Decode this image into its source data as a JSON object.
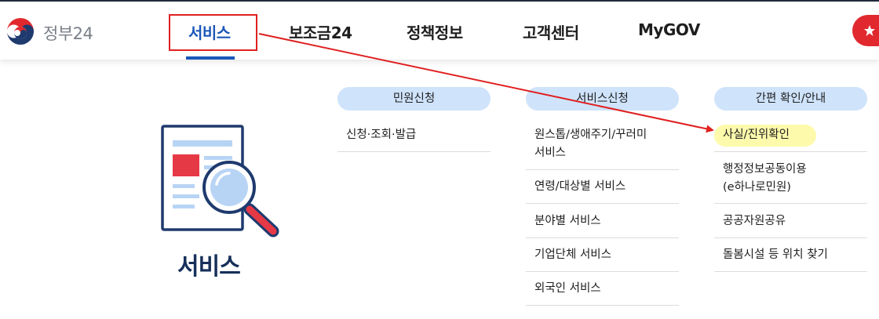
{
  "header": {
    "logo_text": "정부24",
    "nav": [
      {
        "label": "서비스",
        "active": true
      },
      {
        "label": "보조금24"
      },
      {
        "label": "정책정보"
      },
      {
        "label": "고객센터"
      },
      {
        "label": "MyGOV"
      }
    ],
    "accent_color": "#1b57b8"
  },
  "hero": {
    "title": "서비스",
    "illustration": "document-magnifier-icon"
  },
  "columns": [
    {
      "title": "민원신청",
      "items": [
        "신청·조회·발급"
      ]
    },
    {
      "title": "서비스신청",
      "items": [
        "원스톱/생애주기/꾸러미",
        "서비스",
        "연령/대상별 서비스",
        "분야별 서비스",
        "기업단체 서비스",
        "외국인 서비스"
      ]
    },
    {
      "title": "간편 확인/안내",
      "items": [
        "사실/진위확인",
        "행정정보공동이용",
        "(e하나로민원)",
        "공공자원공유",
        "돌봄시설 등 위치 찾기"
      ]
    }
  ],
  "annotation": {
    "box_color": "#e02020",
    "arrow_color": "#e02020",
    "highlight_color": "#fdfaac"
  }
}
